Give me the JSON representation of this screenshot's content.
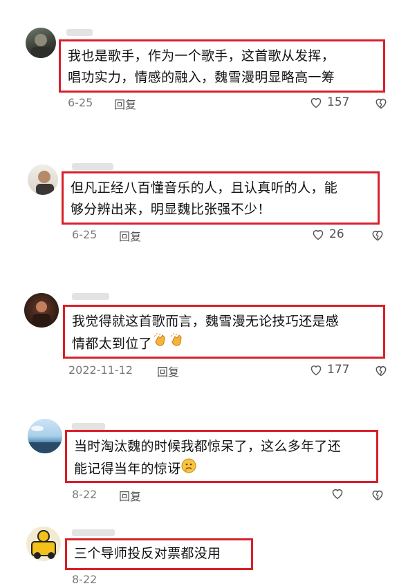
{
  "comments": [
    {
      "text": "我也是歌手，作为一个歌手，这首歌从发挥，\n唱功实力，情感的融入，魏雪漫明显略高一筹",
      "date": "6-25",
      "reply_label": "回复",
      "likes": "157"
    },
    {
      "text": "但凡正经八百懂音乐的人，且认真听的人，能\n够分辨出来，明显魏比张强不少！",
      "date": "6-25",
      "reply_label": "回复",
      "likes": "26"
    },
    {
      "text": "我觉得就这首歌而言，魏雪漫无论技巧还是感\n情都太到位了",
      "date": "2022-11-12",
      "reply_label": "回复",
      "likes": "177"
    },
    {
      "text": "当时淘汰魏的时候我都惊呆了，这么多年了还\n能记得当年的惊讶",
      "date": "8-22",
      "reply_label": "回复",
      "likes": ""
    },
    {
      "text": "三个导师投反对票都没用",
      "date": "8-22",
      "reply_label": "",
      "likes": ""
    }
  ],
  "colors": {
    "highlight_border": "#d8202a",
    "meta_text": "#7a7a7a"
  },
  "icons": [
    "heart-icon",
    "dislike-heart-icon",
    "clapping-hands-emoji",
    "thinking-face-emoji"
  ]
}
